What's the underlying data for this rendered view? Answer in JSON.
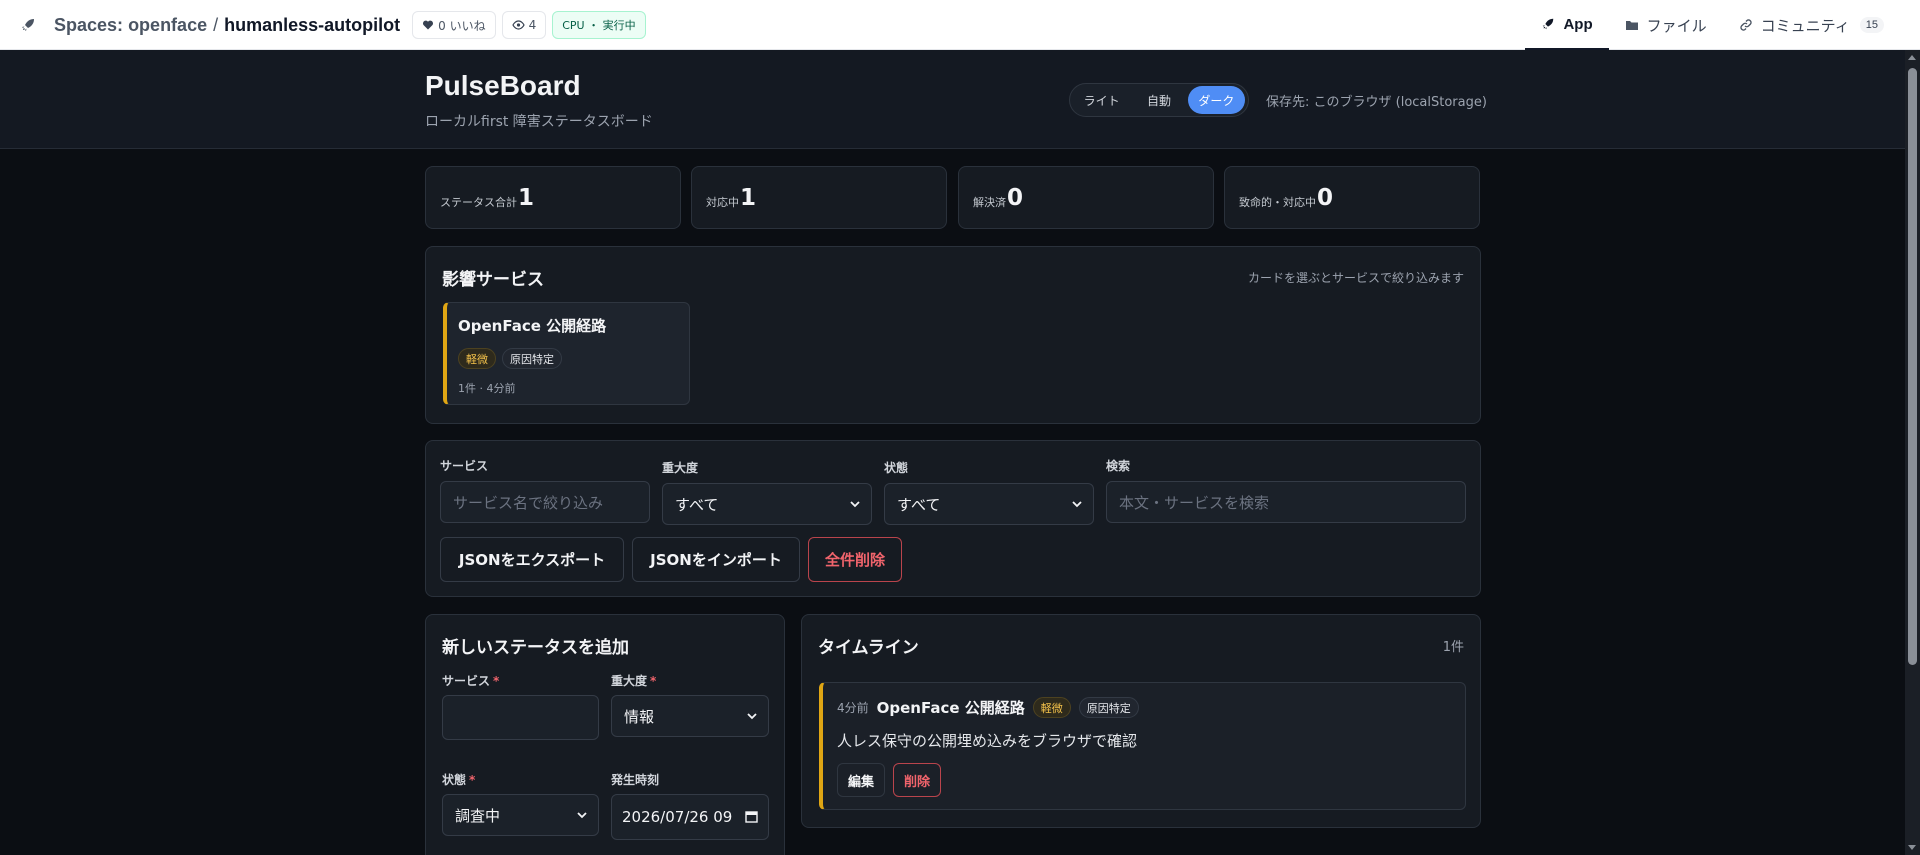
{
  "hf": {
    "space_prefix": "Spaces:",
    "owner": "openface",
    "separator": "/",
    "repo": "humanless-autopilot",
    "likes": "0 いいね",
    "views": "4",
    "hardware": "CPU ・ 実行中",
    "tabs": [
      {
        "label": "App",
        "icon": "rocket-icon"
      },
      {
        "label": "ファイル",
        "icon": "folder-icon"
      },
      {
        "label": "コミュニティ",
        "icon": "link-icon",
        "count": "15"
      }
    ]
  },
  "app": {
    "title": "PulseBoard",
    "subtitle": "ローカルfirst 障害ステータスボード",
    "theme": {
      "light": "ライト",
      "auto": "自動",
      "dark": "ダーク",
      "selected": "dark"
    },
    "storage_note": "保存先: このブラウザ (localStorage)"
  },
  "stats": [
    {
      "label": "ステータス合計",
      "value": "1"
    },
    {
      "label": "対応中",
      "value": "1"
    },
    {
      "label": "解決済",
      "value": "0"
    },
    {
      "label": "致命的・対応中",
      "value": "0"
    }
  ],
  "services": {
    "title": "影響サービス",
    "hint": "カードを選ぶとサービスで絞り込みます",
    "cards": [
      {
        "name": "OpenFace 公開経路",
        "severity": "軽微",
        "state": "原因特定",
        "meta": "1件 · 4分前",
        "accent": "#e0a614"
      }
    ]
  },
  "filters": {
    "service_label": "サービス",
    "service_placeholder": "サービス名で絞り込み",
    "severity_label": "重大度",
    "severity_value": "すべて",
    "state_label": "状態",
    "state_value": "すべて",
    "search_label": "検索",
    "search_placeholder": "本文・サービスを検索",
    "export": "JSONをエクスポート",
    "import": "JSONをインポート",
    "clear": "全件削除"
  },
  "new_status": {
    "title": "新しいステータスを追加",
    "service_label": "サービス",
    "severity_label": "重大度",
    "severity_value": "情報",
    "state_label": "状態",
    "state_value": "調査中",
    "time_label": "発生時刻",
    "time_value": "2026/07/26 09"
  },
  "timeline": {
    "title": "タイムライン",
    "count": "1件",
    "items": [
      {
        "time": "4分前",
        "service": "OpenFace 公開経路",
        "severity": "軽微",
        "state": "原因特定",
        "body": "人レス保守の公開埋め込みをブラウザで確認",
        "edit": "編集",
        "delete": "削除"
      }
    ]
  },
  "colors": {
    "accent": "#4f8df5",
    "warning": "#e0a614",
    "danger": "#f0646c",
    "background": "#0b0e13"
  }
}
